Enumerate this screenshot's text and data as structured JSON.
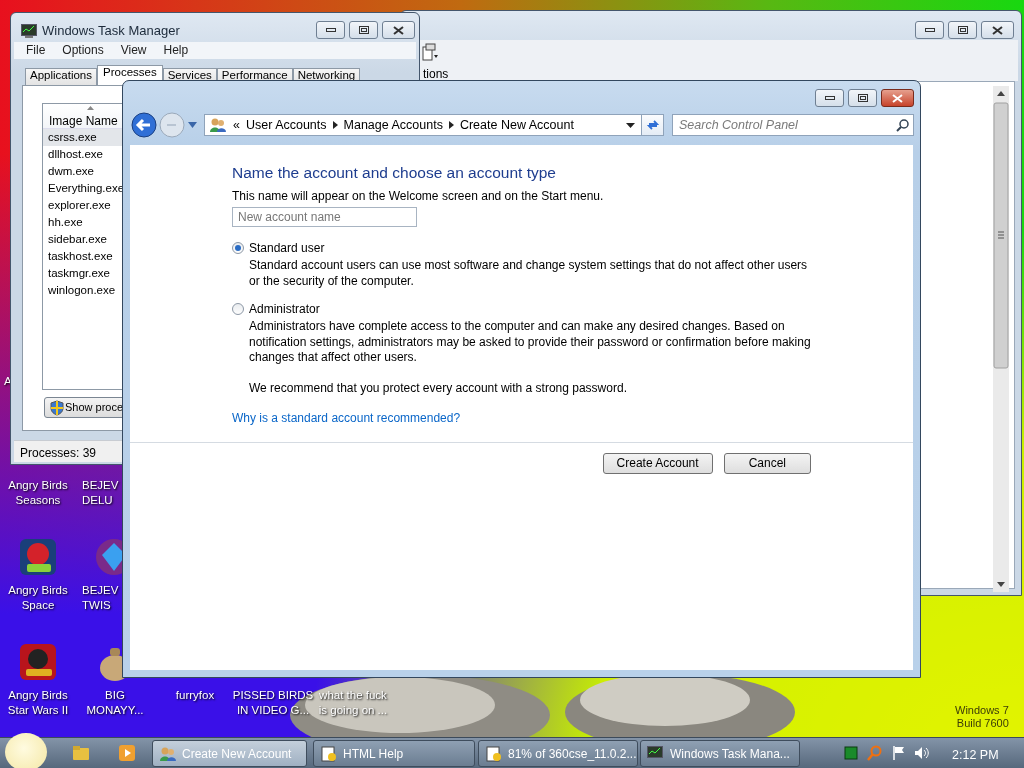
{
  "desktop_icons": [
    {
      "label": "Angry Birds\nSeasons",
      "kind": "covered"
    },
    {
      "label": "BEJEV\nDELU",
      "kind": "covered"
    },
    {
      "label": "Angry Birds\nSpace",
      "kind": "space"
    },
    {
      "label": "BEJEV\nTWIS",
      "kind": "gem"
    },
    {
      "label": "Angry Birds\nStar Wars II",
      "kind": "starwars"
    },
    {
      "label": "BIG\nMONAYY...",
      "kind": "bag"
    },
    {
      "label": "furryfox",
      "kind": "covered"
    },
    {
      "label": "PISSED BIRDS\nIN VIDEO G...",
      "kind": "covered"
    },
    {
      "label": "what the fuck\nis going on ...",
      "kind": "covered"
    },
    {
      "label": "A",
      "kind": "covered"
    }
  ],
  "back_window": {
    "toolbar_label": "tions"
  },
  "task_manager": {
    "title": "Windows Task Manager",
    "menu": [
      "File",
      "Options",
      "View",
      "Help"
    ],
    "tabs": [
      {
        "label": "Applications",
        "selected": false
      },
      {
        "label": "Processes",
        "selected": true
      },
      {
        "label": "Services",
        "selected": false
      },
      {
        "label": "Performance",
        "selected": false
      },
      {
        "label": "Networking",
        "selected": false
      }
    ],
    "column": "Image Name",
    "processes": [
      {
        "name": "csrss.exe",
        "selected": true
      },
      {
        "name": "dllhost.exe",
        "selected": false
      },
      {
        "name": "dwm.exe",
        "selected": false
      },
      {
        "name": "Everything.exe",
        "selected": false
      },
      {
        "name": "explorer.exe",
        "selected": false
      },
      {
        "name": "hh.exe",
        "selected": false
      },
      {
        "name": "sidebar.exe",
        "selected": false
      },
      {
        "name": "taskhost.exe",
        "selected": false
      },
      {
        "name": "taskmgr.exe",
        "selected": false
      },
      {
        "name": "winlogon.exe",
        "selected": false
      }
    ],
    "show_button": "Show proce",
    "status": "Processes: 39"
  },
  "dialog": {
    "overflow_mark": "«",
    "breadcrumb": [
      "User Accounts",
      "Manage Accounts",
      "Create New Account"
    ],
    "search": {
      "placeholder": "Search Control Panel"
    },
    "heading": "Name the account and choose an account type",
    "intro": "This name will appear on the Welcome screen and on the Start menu.",
    "name_field": {
      "placeholder": "New account name"
    },
    "account_types": [
      {
        "label": "Standard user",
        "description": "Standard account users can use most software and change system settings that do not affect other users or the security of the computer.",
        "selected": true
      },
      {
        "label": "Administrator",
        "description": "Administrators have complete access to the computer and can make any desired changes. Based on notification settings, administrators may be asked to provide their password or confirmation before making changes that affect other users.",
        "selected": false
      }
    ],
    "recommendation": "We recommend that you protect every account with a strong password.",
    "help_link": "Why is a standard account recommended?",
    "buttons": [
      "Create Account",
      "Cancel"
    ]
  },
  "taskbar": {
    "tasks": [
      {
        "label": "Create New Account",
        "selected": true
      },
      {
        "label": "HTML Help",
        "selected": false
      },
      {
        "label": "81% of 360cse_11.0.2...",
        "selected": false
      },
      {
        "label": "Windows Task Mana...",
        "selected": false
      }
    ],
    "clock": "2:12 PM"
  },
  "os_watermark": [
    "Windows 7",
    "Build 7600"
  ]
}
